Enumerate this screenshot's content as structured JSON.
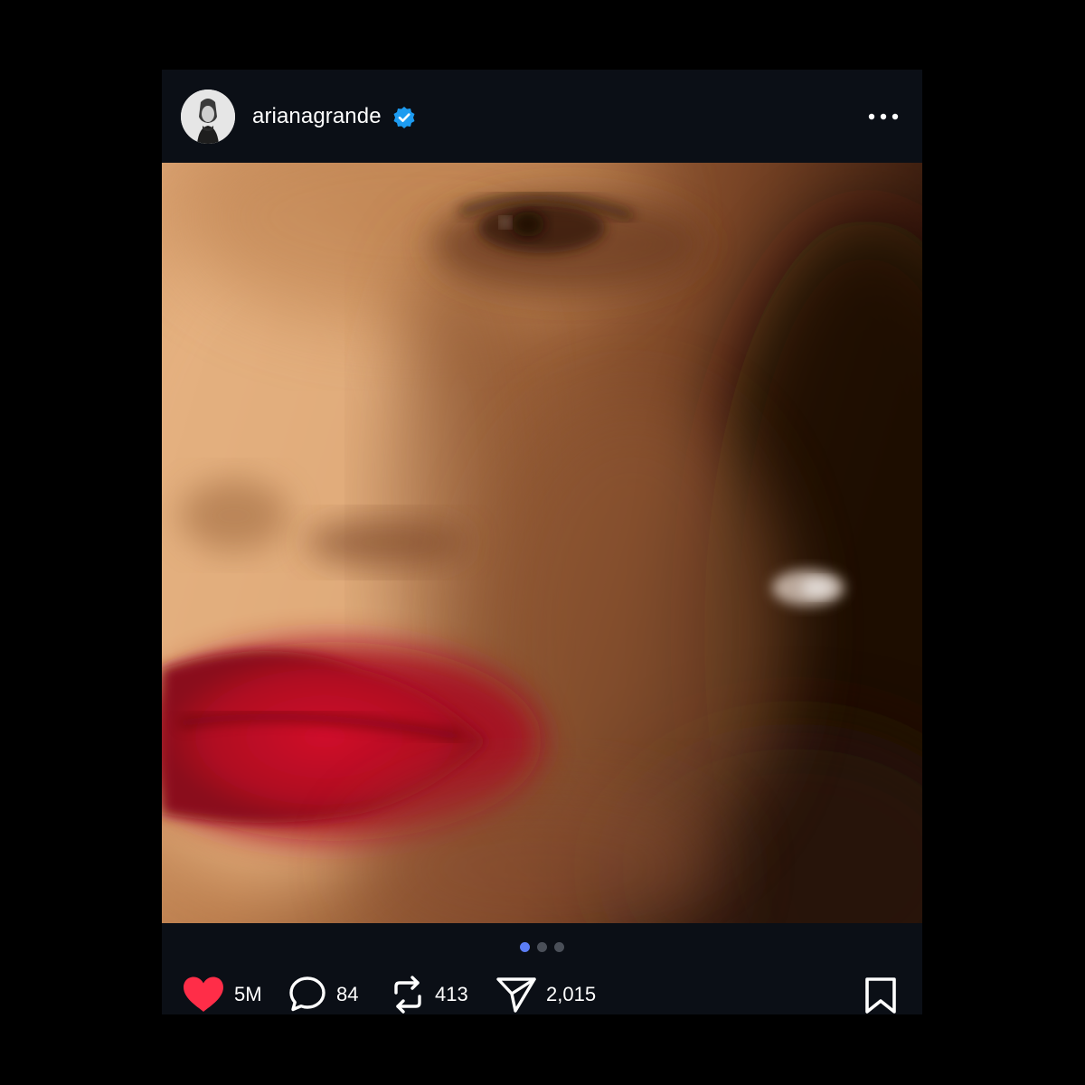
{
  "post": {
    "username": "arianagrande",
    "verified": true,
    "avatar_icon": "profile-photo",
    "more_icon": "more-horizontal-icon",
    "carousel": {
      "total_slides": 3,
      "active_index": 0
    },
    "actions": {
      "like_count": "5M",
      "comment_count": "84",
      "repost_count": "413",
      "share_count": "2,015"
    }
  },
  "colors": {
    "background": "#000000",
    "card": "#0b0f16",
    "text": "#ffffff",
    "verified_blue": "#1d9bf0",
    "like_red": "#ff2d48",
    "dot_active": "#5b7df5",
    "dot_inactive": "#4a4f58"
  }
}
